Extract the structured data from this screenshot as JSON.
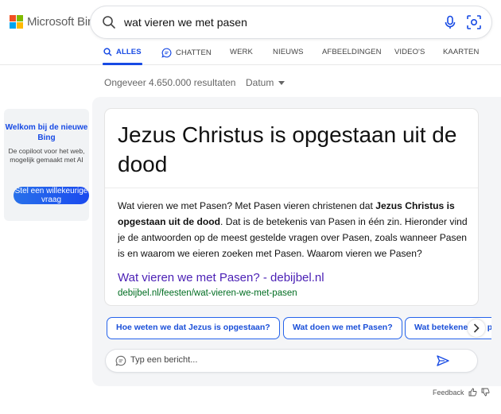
{
  "brand": {
    "name": "Microsoft Bing",
    "colors": [
      "#f25022",
      "#7fba00",
      "#00a4ef",
      "#ffb900"
    ]
  },
  "search": {
    "query": "wat vieren we met pasen"
  },
  "tabs": [
    {
      "label": "ALLES",
      "active": true
    },
    {
      "label": "CHATTEN",
      "active": false
    },
    {
      "label": "WERK",
      "active": false
    },
    {
      "label": "NIEUWS",
      "active": false
    },
    {
      "label": "AFBEELDINGEN",
      "active": false
    },
    {
      "label": "VIDEO'S",
      "active": false
    },
    {
      "label": "KAARTEN",
      "active": false
    }
  ],
  "results": {
    "count_text": "Ongeveer 4.650.000 resultaten",
    "date_filter": "Datum"
  },
  "promo": {
    "title": "Welkom bij de nieuwe Bing",
    "description": "De copiloot voor het web, mogelijk gemaakt met AI",
    "button": "Stel een willekeurige vraag"
  },
  "answer": {
    "heading": "Jezus Christus is opgestaan uit de dood",
    "body_pre": "Wat vieren we met Pasen? Met Pasen vieren christenen dat ",
    "body_bold": "Jezus Christus is opgestaan uit de dood",
    "body_post": ". Dat is de betekenis van Pasen in één zin. Hieronder vind je de antwoorden op de meest gestelde vragen over Pasen, zoals wanneer Pasen is en waarom we eieren zoeken met Pasen. Waarom vieren we Pasen?",
    "link_title": "Wat vieren we met Pasen? - debijbel.nl",
    "link_url": "debijbel.nl/feesten/wat-vieren-we-met-pasen"
  },
  "suggestions": [
    "Hoe weten we dat Jezus is opgestaan?",
    "Wat doen we met Pasen?",
    "Wat betekenen de paaseieren?"
  ],
  "composer": {
    "placeholder": "Typ een bericht..."
  },
  "feedback": {
    "label": "Feedback"
  },
  "accent": "#174ae4"
}
